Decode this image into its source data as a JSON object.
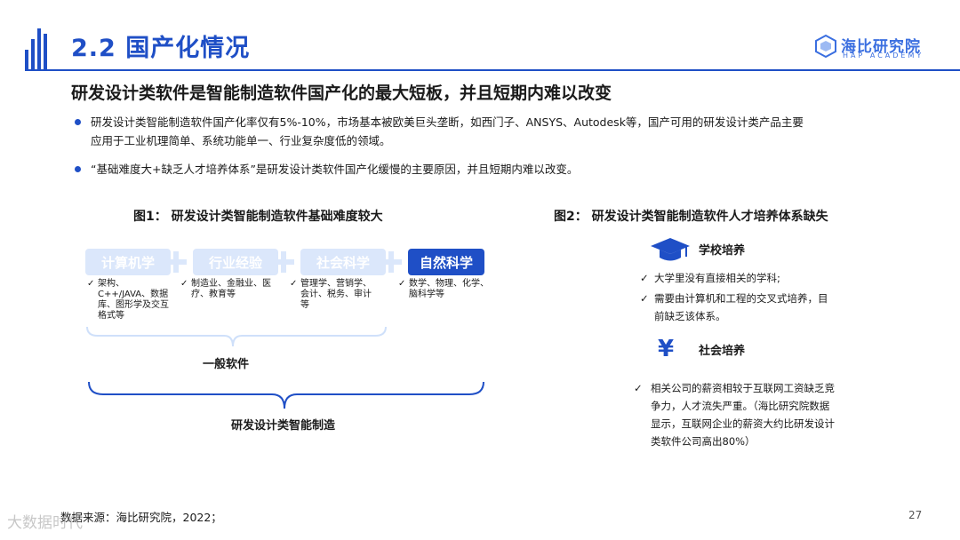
{
  "header": {
    "title": "2.2 国产化情况",
    "logo_name": "海比研究院",
    "logo_sub": "HAP ACADEMY"
  },
  "subtitle": "研发设计类软件是智能制造软件国产化的最大短板，并且短期内难以改变",
  "bullets": [
    "研发设计类智能制造软件国产化率仅有5%-10%，市场基本被欧美巨头垄断，如西门子、ANSYS、Autodesk等，国产可用的研发设计类产品主要应用于工业机理简单、系统功能单一、行业复杂度低的领域。",
    "“基础难度大+缺乏人才培养体系”是研发设计类软件国产化缓慢的主要原因，并且短期内难以改变。"
  ],
  "figure1": {
    "title": "图1：  研发设计类智能制造软件基础难度较大",
    "boxes": [
      {
        "label": "计算机学",
        "detail": "架构、C++/JAVA、数据库、图形学及交互格式等"
      },
      {
        "label": "行业经验",
        "detail": "制造业、金融业、医疗、教育等"
      },
      {
        "label": "社会科学",
        "detail": "管理学、营销学、会计、税务、审计等"
      },
      {
        "label": "自然科学",
        "detail": "数学、物理、化学、脑科学等"
      }
    ],
    "check": "✓",
    "brace_small_label": "一般软件",
    "brace_large_label": "研发设计类智能制造"
  },
  "figure2": {
    "title": "图2：  研发设计类智能制造软件人才培养体系缺失",
    "check": "✓",
    "school": {
      "icon": "graduation-cap-icon",
      "heading": "学校培养",
      "items": [
        "大学里没有直接相关的学科;",
        "需要由计算机和工程的交叉式培养，目前缺乏该体系。"
      ]
    },
    "society": {
      "icon": "yen-icon",
      "icon_glyph": "¥",
      "heading": "社会培养",
      "items": [
        "相关公司的薪资相较于互联网工资缺乏竞争力，人才流失严重。（海比研究院数据显示，互联网企业的薪资大约比研发设计类软件公司高出80%）"
      ]
    }
  },
  "footer": {
    "source": "数据来源：海比研究院，2022；",
    "page": "27",
    "watermark": "大数据时代"
  },
  "colors": {
    "accent": "#1f4fc6",
    "light_box": "#dbe7fb",
    "brace": "#1f4fc6"
  }
}
